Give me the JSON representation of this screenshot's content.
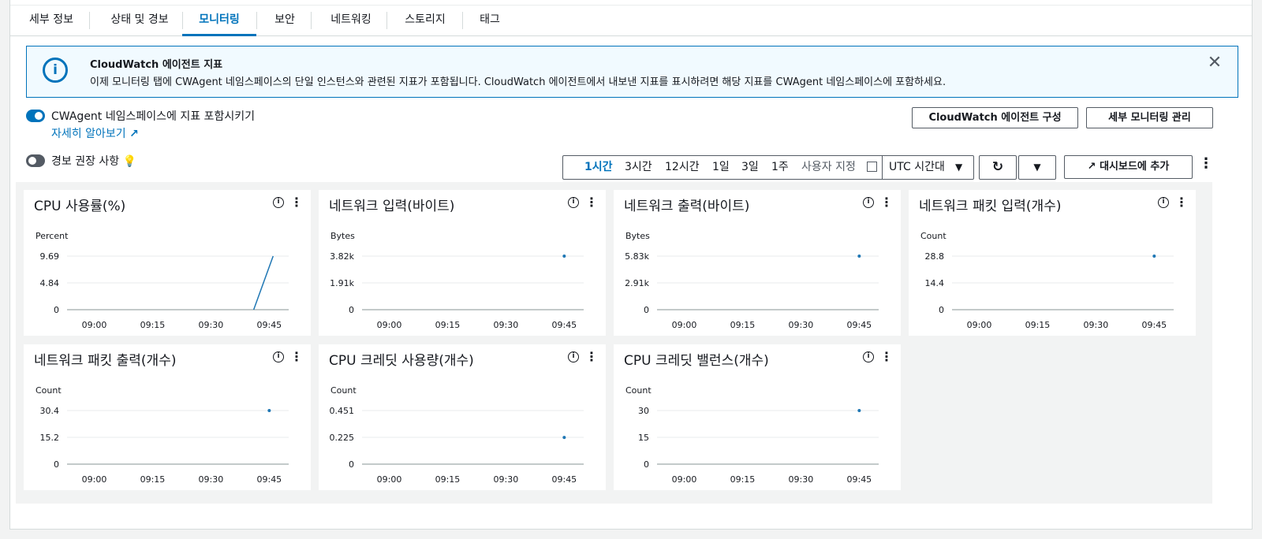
{
  "tabs": [
    {
      "label": "세부 정보"
    },
    {
      "label": "상태 및 경보"
    },
    {
      "label": "모니터링",
      "active": true
    },
    {
      "label": "보안"
    },
    {
      "label": "네트워킹"
    },
    {
      "label": "스토리지"
    },
    {
      "label": "태그"
    }
  ],
  "banner": {
    "title": "CloudWatch 에이전트 지표",
    "body": "이제 모니터링 탭에 CWAgent 네임스페이스의 단일 인스턴스와 관련된 지표가 포함됩니다. CloudWatch 에이전트에서 내보낸 지표를 표시하려면 해당 지표를 CWAgent 네임스페이스에 포함하세요.",
    "close_icon": "close-icon",
    "info_icon": "info-icon"
  },
  "cwagent_toggle": {
    "label": "CWAgent 네임스페이스에 지표 포함시키기",
    "on": true
  },
  "learn_more": "자세히 알아보기",
  "alarm_toggle": {
    "label": "경보 권장 사항",
    "on": false
  },
  "buttons": {
    "configure_agent": "CloudWatch 에이전트 구성",
    "manage_monitoring": "세부 모니터링 관리",
    "add_dashboard": "대시보드에 추가"
  },
  "time_ranges": [
    "1시간",
    "3시간",
    "12시간",
    "1일",
    "3일",
    "1주"
  ],
  "time_active": "1시간",
  "custom_range": "사용자 지정",
  "timezone": "UTC 시간대",
  "chart_data": [
    {
      "type": "line",
      "title": "CPU 사용률(%)",
      "unit": "Percent",
      "yticks": [
        "9.69",
        "4.84",
        "0"
      ],
      "ylim": [
        0,
        9.69
      ],
      "xticks": [
        "09:00",
        "09:15",
        "09:30",
        "09:45"
      ],
      "series": [
        {
          "x": [
            "09:41",
            "09:46"
          ],
          "y": [
            0,
            9.69
          ]
        }
      ]
    },
    {
      "type": "scatter",
      "title": "네트워크 입력(바이트)",
      "unit": "Bytes",
      "yticks": [
        "3.82k",
        "1.91k",
        "0"
      ],
      "ylim": [
        0,
        3820
      ],
      "xticks": [
        "09:00",
        "09:15",
        "09:30",
        "09:45"
      ],
      "series": [
        {
          "x": [
            "09:45"
          ],
          "y": [
            3820
          ]
        }
      ]
    },
    {
      "type": "scatter",
      "title": "네트워크 출력(바이트)",
      "unit": "Bytes",
      "yticks": [
        "5.83k",
        "2.91k",
        "0"
      ],
      "ylim": [
        0,
        5830
      ],
      "xticks": [
        "09:00",
        "09:15",
        "09:30",
        "09:45"
      ],
      "series": [
        {
          "x": [
            "09:45"
          ],
          "y": [
            5830
          ]
        }
      ]
    },
    {
      "type": "scatter",
      "title": "네트워크 패킷 입력(개수)",
      "unit": "Count",
      "yticks": [
        "28.8",
        "14.4",
        "0"
      ],
      "ylim": [
        0,
        28.8
      ],
      "xticks": [
        "09:00",
        "09:15",
        "09:30",
        "09:45"
      ],
      "series": [
        {
          "x": [
            "09:45"
          ],
          "y": [
            28.8
          ]
        }
      ]
    },
    {
      "type": "scatter",
      "title": "네트워크 패킷 출력(개수)",
      "unit": "Count",
      "yticks": [
        "30.4",
        "15.2",
        "0"
      ],
      "ylim": [
        0,
        30.4
      ],
      "xticks": [
        "09:00",
        "09:15",
        "09:30",
        "09:45"
      ],
      "series": [
        {
          "x": [
            "09:45"
          ],
          "y": [
            30.4
          ]
        }
      ]
    },
    {
      "type": "scatter",
      "title": "CPU 크레딧 사용량(개수)",
      "unit": "Count",
      "yticks": [
        "0.451",
        "0.225",
        "0"
      ],
      "ylim": [
        0,
        0.451
      ],
      "xticks": [
        "09:00",
        "09:15",
        "09:30",
        "09:45"
      ],
      "series": [
        {
          "x": [
            "09:45"
          ],
          "y": [
            0.225
          ]
        }
      ]
    },
    {
      "type": "scatter",
      "title": "CPU 크레딧 밸런스(개수)",
      "unit": "Count",
      "yticks": [
        "30",
        "15",
        "0"
      ],
      "ylim": [
        0,
        30
      ],
      "xticks": [
        "09:00",
        "09:15",
        "09:30",
        "09:45"
      ],
      "series": [
        {
          "x": [
            "09:45"
          ],
          "y": [
            30
          ]
        }
      ]
    }
  ],
  "colors": {
    "accent": "#0073bb",
    "line": "#1f77b4"
  }
}
